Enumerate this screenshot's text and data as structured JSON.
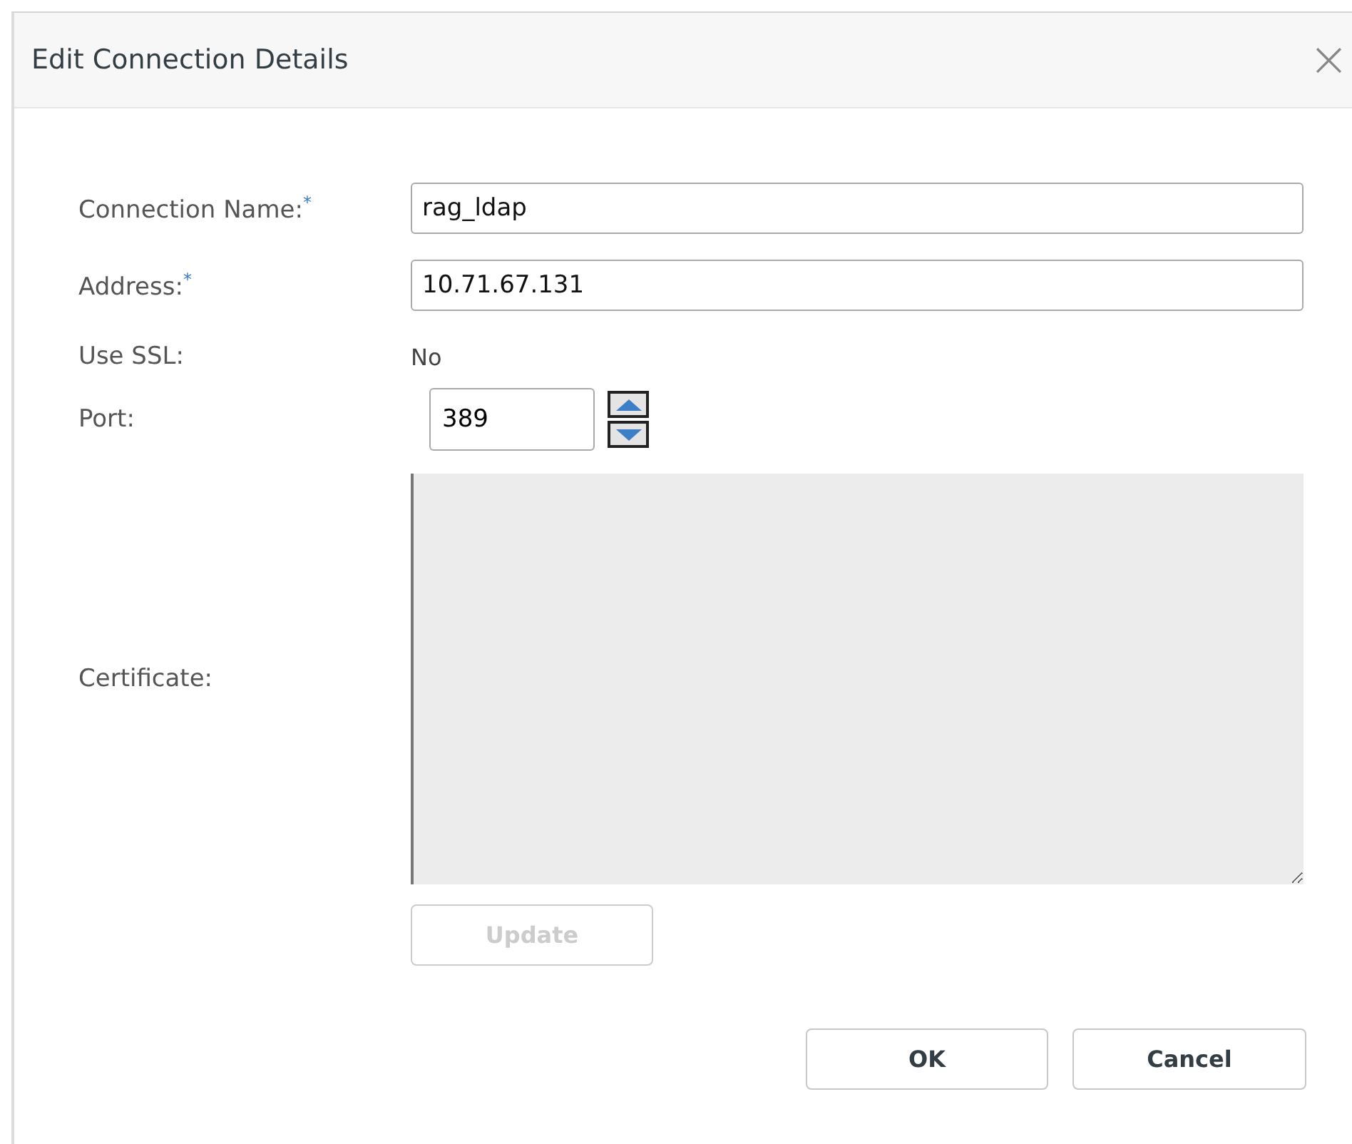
{
  "dialog": {
    "title": "Edit Connection Details",
    "close": "×"
  },
  "fields": [
    {
      "kind": "text",
      "label": "Connection Name:$^{*}$",
      "value": "rag_ldap"
    },
    {
      "kind": "text",
      "label": "Address:$^{*}$",
      "value": "10.71.67.131"
    },
    {
      "kind": "static",
      "label": "Use SSL:",
      "value": "No"
    },
    {
      "kind": "spinner",
      "label": "Port:",
      "value": "389"
    },
    {
      "kind": "textarea",
      "label": "Certificate:",
      "disabled": true
    }
  ],
  "update_button": {
    "label": "Update",
    "disabled": true
  },
  "buttons": [
    "OK",
    "Cancel"
  ]
}
